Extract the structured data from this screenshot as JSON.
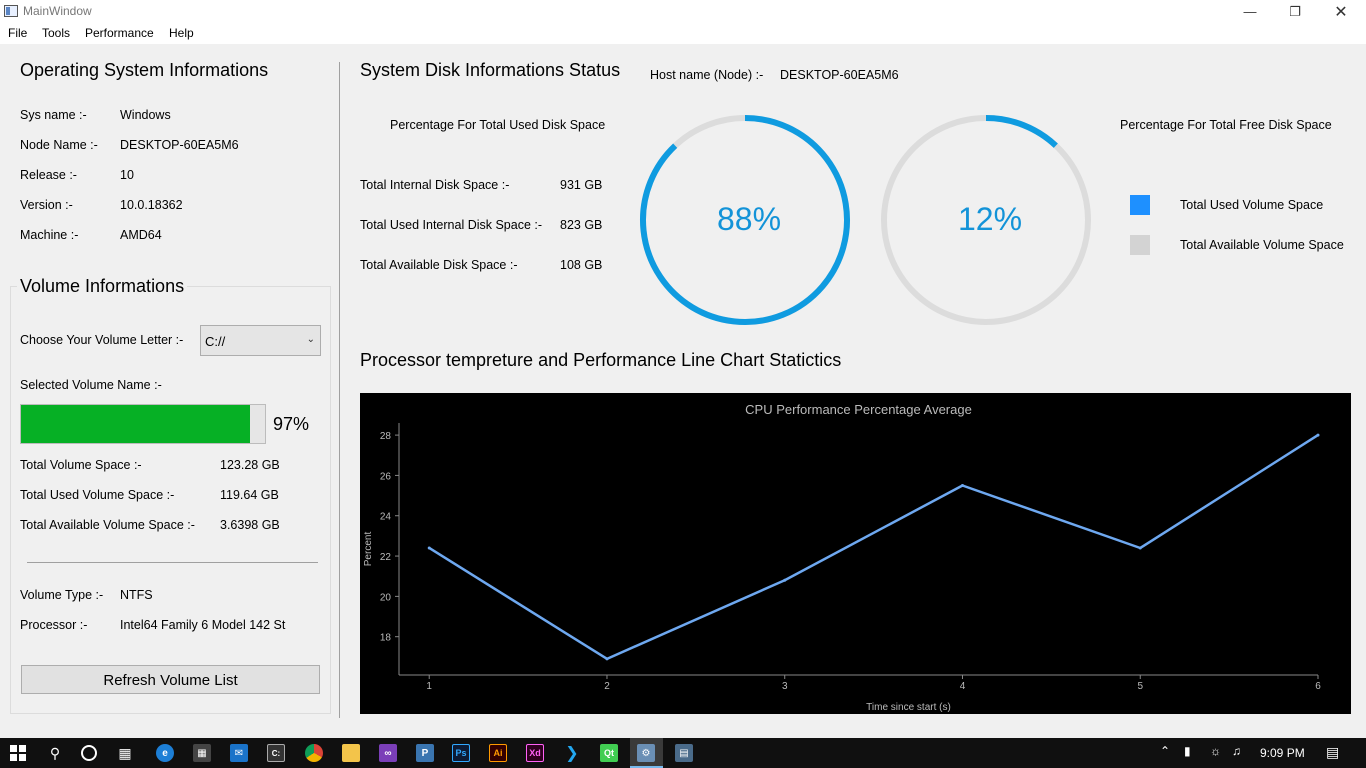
{
  "window": {
    "title": "MainWindow"
  },
  "menu": [
    "File",
    "Tools",
    "Performance",
    "Help"
  ],
  "os": {
    "heading": "Operating System Informations",
    "rows": [
      {
        "label": "Sys name :-",
        "value": "Windows"
      },
      {
        "label": "Node Name :-",
        "value": "DESKTOP-60EA5M6"
      },
      {
        "label": "Release :-",
        "value": "10"
      },
      {
        "label": "Version :-",
        "value": "10.0.18362"
      },
      {
        "label": "Machine :-",
        "value": "AMD64"
      }
    ]
  },
  "volume": {
    "heading": "Volume Informations",
    "choose_label": "Choose Your Volume Letter :-",
    "selected_letter": "C://",
    "selected_name_label": "Selected Volume Name :-",
    "usage_fraction": 0.97,
    "usage_text": "97%",
    "rows": [
      {
        "label": "Total Volume Space :-",
        "value": "123.28 GB"
      },
      {
        "label": "Total Used Volume Space :-",
        "value": "119.64 GB"
      },
      {
        "label": "Total Available Volume Space :-",
        "value": "3.6398 GB"
      }
    ],
    "type_label": "Volume Type :-",
    "type_value": "NTFS",
    "processor_label": "Processor :-",
    "processor_value": "Intel64 Family 6 Model 142 St",
    "refresh_label": "Refresh Volume List"
  },
  "disk": {
    "heading": "System Disk Informations Status",
    "host_label": "Host name (Node) :-",
    "host_value": "DESKTOP-60EA5M6",
    "used_pct_label": "Percentage For Total Used Disk Space",
    "free_pct_label": "Percentage For Total Free Disk Space",
    "rows": [
      {
        "label": "Total Internal Disk Space :-",
        "value": "931 GB"
      },
      {
        "label": "Total Used Internal Disk Space :-",
        "value": "823 GB"
      },
      {
        "label": "Total Available Disk Space :-",
        "value": "108 GB"
      }
    ],
    "used_gauge": {
      "fraction": 0.88,
      "text": "88%"
    },
    "free_gauge": {
      "fraction": 0.12,
      "text": "12%"
    },
    "legend": [
      {
        "label": "Total Used Volume Space",
        "color": "#1e90ff"
      },
      {
        "label": "Total Available Volume Space",
        "color": "#d3d3d3"
      }
    ],
    "gauge_colors": {
      "arc": "#0f9be0",
      "track": "#dcdcdc"
    }
  },
  "perf": {
    "heading": "Processor tempreture and Performance Line Chart Statictics"
  },
  "chart_data": {
    "type": "line",
    "title": "CPU Performance Percentage Average",
    "xlabel": "Time since start (s)",
    "ylabel": "Percent",
    "x": [
      1,
      2,
      3,
      4,
      5,
      6
    ],
    "y": [
      22.4,
      16.9,
      20.8,
      25.5,
      22.4,
      28.0
    ],
    "xlim": [
      0.83,
      6.0
    ],
    "ylim": [
      16.1,
      28.6
    ],
    "yticks": [
      18,
      20,
      22,
      24,
      26,
      28
    ],
    "xticks": [
      1,
      2,
      3,
      4,
      5,
      6
    ],
    "line_color": "#6ea8f0",
    "background": "#000000"
  },
  "taskbar": {
    "time": "9:09 PM",
    "icons": [
      "windows-icon",
      "search-icon",
      "cortana-icon",
      "task-view-icon",
      "edge-icon",
      "store-icon",
      "mail-icon",
      "cmd-icon",
      "chrome-icon",
      "file-explorer-icon",
      "visual-studio-icon",
      "python-icon",
      "photoshop-icon",
      "illustrator-icon",
      "xd-icon",
      "vscode-icon",
      "qt-icon",
      "app-icon",
      "monitor-app-icon"
    ]
  }
}
